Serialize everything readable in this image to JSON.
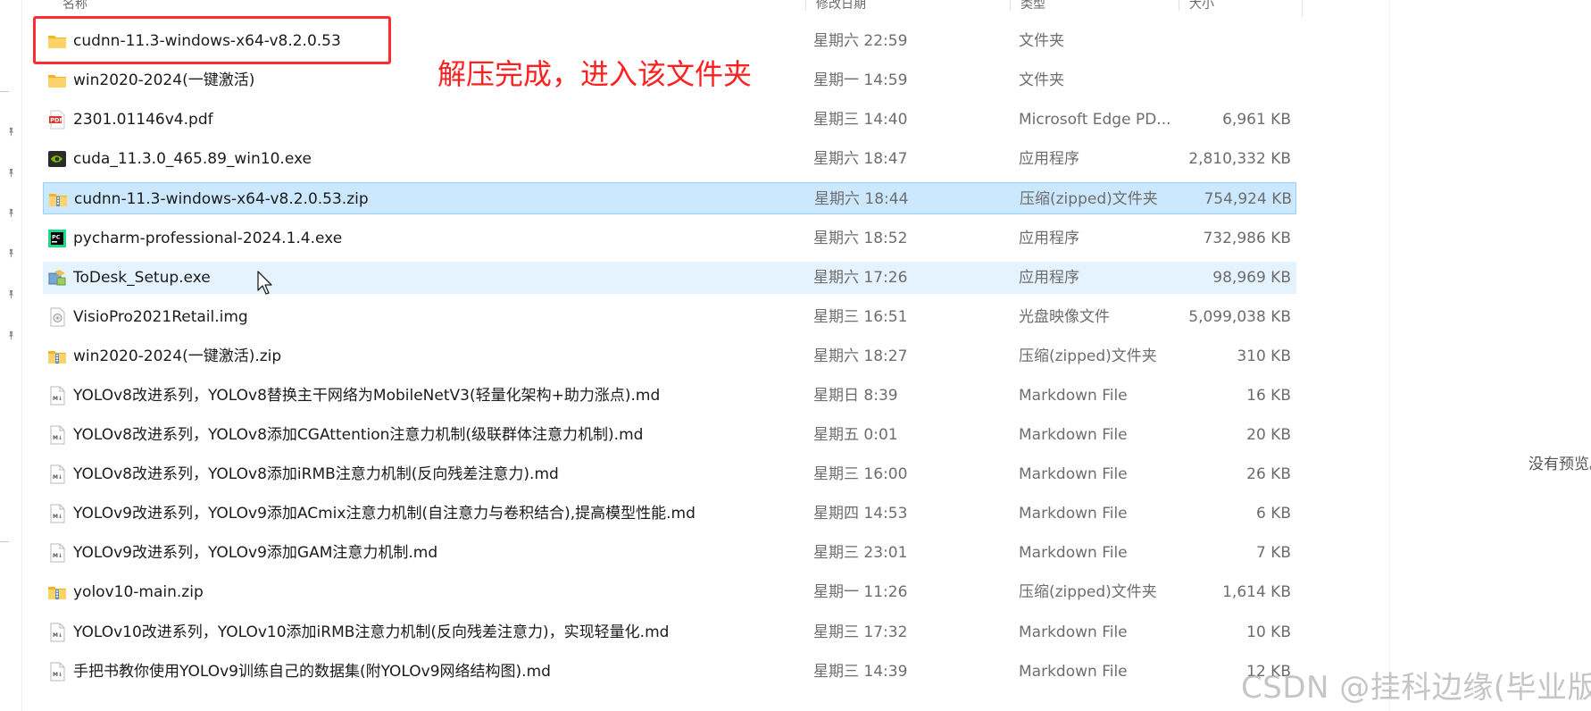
{
  "columns": {
    "name": "名称",
    "date": "修改日期",
    "type": "类型",
    "size": "大小"
  },
  "files": [
    {
      "name": "cudnn-11.3-windows-x64-v8.2.0.53",
      "date": "星期六 22:59",
      "type": "文件夹",
      "size": "",
      "icon": "folder-icon"
    },
    {
      "name": "win2020-2024(一键激活)",
      "date": "星期一 14:59",
      "type": "文件夹",
      "size": "",
      "icon": "folder-icon"
    },
    {
      "name": "2301.01146v4.pdf",
      "date": "星期三 14:40",
      "type": "Microsoft Edge PD...",
      "size": "6,961 KB",
      "icon": "pdf-icon"
    },
    {
      "name": "cuda_11.3.0_465.89_win10.exe",
      "date": "星期六 18:47",
      "type": "应用程序",
      "size": "2,810,332 KB",
      "icon": "nvidia-exe-icon"
    },
    {
      "name": "cudnn-11.3-windows-x64-v8.2.0.53.zip",
      "date": "星期六 18:44",
      "type": "压缩(zipped)文件夹",
      "size": "754,924 KB",
      "icon": "zip-folder-icon"
    },
    {
      "name": "pycharm-professional-2024.1.4.exe",
      "date": "星期六 18:52",
      "type": "应用程序",
      "size": "732,986 KB",
      "icon": "pycharm-icon"
    },
    {
      "name": "ToDesk_Setup.exe",
      "date": "星期六 17:26",
      "type": "应用程序",
      "size": "98,969 KB",
      "icon": "installer-icon"
    },
    {
      "name": "VisioPro2021Retail.img",
      "date": "星期三 16:51",
      "type": "光盘映像文件",
      "size": "5,099,038 KB",
      "icon": "disc-image-icon"
    },
    {
      "name": "win2020-2024(一键激活).zip",
      "date": "星期六 18:27",
      "type": "压缩(zipped)文件夹",
      "size": "310 KB",
      "icon": "zip-folder-icon"
    },
    {
      "name": "YOLOv8改进系列，YOLOv8替换主干网络为MobileNetV3(轻量化架构+助力涨点).md",
      "date": "星期日 8:39",
      "type": "Markdown File",
      "size": "16 KB",
      "icon": "markdown-file-icon"
    },
    {
      "name": "YOLOv8改进系列，YOLOv8添加CGAttention注意力机制(级联群体注意力机制).md",
      "date": "星期五 0:01",
      "type": "Markdown File",
      "size": "20 KB",
      "icon": "markdown-file-icon"
    },
    {
      "name": "YOLOv8改进系列，YOLOv8添加iRMB注意力机制(反向残差注意力).md",
      "date": "星期三 16:00",
      "type": "Markdown File",
      "size": "26 KB",
      "icon": "markdown-file-icon"
    },
    {
      "name": "YOLOv9改进系列，YOLOv9添加ACmix注意力机制(自注意力与卷积结合),提高模型性能.md",
      "date": "星期四 14:53",
      "type": "Markdown File",
      "size": "6 KB",
      "icon": "markdown-file-icon"
    },
    {
      "name": "YOLOv9改进系列，YOLOv9添加GAM注意力机制.md",
      "date": "星期三 23:01",
      "type": "Markdown File",
      "size": "7 KB",
      "icon": "markdown-file-icon"
    },
    {
      "name": "yolov10-main.zip",
      "date": "星期一 11:26",
      "type": "压缩(zipped)文件夹",
      "size": "1,614 KB",
      "icon": "zip-folder-icon"
    },
    {
      "name": "YOLOv10改进系列，YOLOv10添加iRMB注意力机制(反向残差注意力)，实现轻量化.md",
      "date": "星期三 17:32",
      "type": "Markdown File",
      "size": "10 KB",
      "icon": "markdown-file-icon"
    },
    {
      "name": "手把书教你使用YOLOv9训练自己的数据集(附YOLOv9网络结构图).md",
      "date": "星期三 14:39",
      "type": "Markdown File",
      "size": "12 KB",
      "icon": "markdown-file-icon"
    }
  ],
  "selected_row": 4,
  "hover_row": 6,
  "annotation": {
    "text": "解压完成，进入该文件夹",
    "color": "#ff2020"
  },
  "preview": {
    "text": "没有预览。"
  },
  "watermark": {
    "text": "CSDN @挂科边缘(毕业版)"
  },
  "colors": {
    "selection": "#cce8ff",
    "hover": "#e5f3ff",
    "folder": "#f4c542",
    "highlight_box": "#ff2d2d"
  }
}
